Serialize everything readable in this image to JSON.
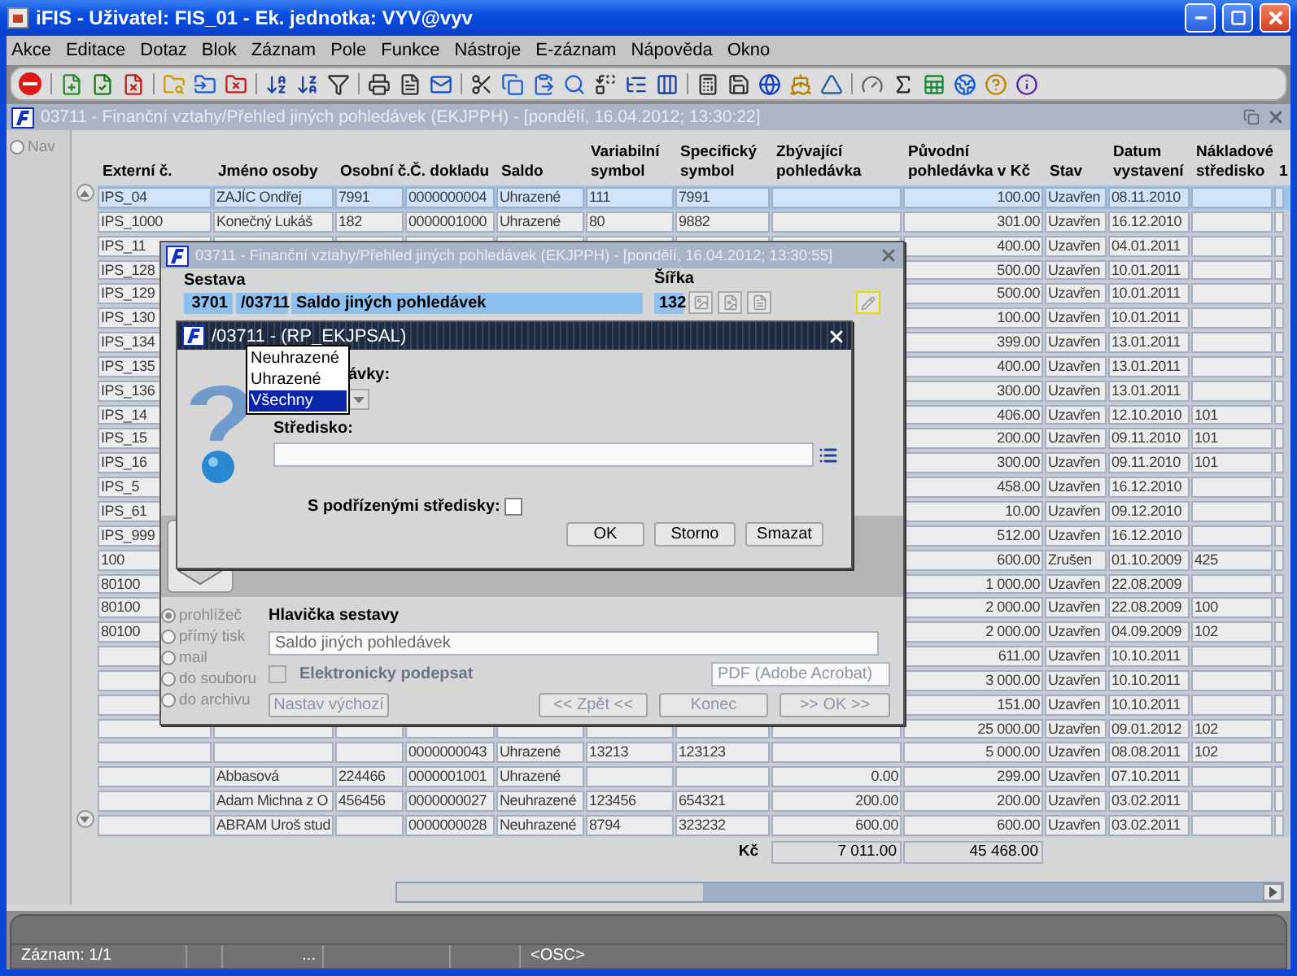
{
  "window": {
    "title": "iFIS - Uživatel: FIS_01 - Ek. jednotka: VYV@vyv"
  },
  "menu": [
    "Akce",
    "Editace",
    "Dotaz",
    "Blok",
    "Záznam",
    "Pole",
    "Funkce",
    "Nástroje",
    "E-záznam",
    "Nápověda",
    "Okno"
  ],
  "inner_window": {
    "title": "03711 - Finanční vztahy/Přehled jiných pohledávek (EKJPPH) - [pondělí, 16.04.2012; 13:30:22]"
  },
  "nav": {
    "label": "Nav"
  },
  "table": {
    "columns": [
      {
        "lines": [
          "Externí č."
        ]
      },
      {
        "lines": [
          "Jméno osoby"
        ]
      },
      {
        "lines": [
          "Osobní č."
        ]
      },
      {
        "lines": [
          "Č. dokladu"
        ]
      },
      {
        "lines": [
          "Saldo"
        ]
      },
      {
        "lines": [
          "Variabilní",
          "symbol"
        ]
      },
      {
        "lines": [
          "Specifický",
          "symbol"
        ]
      },
      {
        "lines": [
          "Zbývající",
          "pohledávka"
        ]
      },
      {
        "lines": [
          "Původní",
          "pohledávka v Kč"
        ]
      },
      {
        "lines": [
          "Stav"
        ]
      },
      {
        "lines": [
          "Datum",
          "vystavení"
        ]
      },
      {
        "lines": [
          "Nákladové",
          "středisko"
        ]
      },
      {
        "lines": [
          "1"
        ]
      }
    ],
    "rows": [
      {
        "selected": true,
        "cells": [
          "IPS_04",
          "ZAJÍC Ondřej",
          "7991",
          "0000000004",
          "Uhrazené",
          "111",
          "7991",
          null,
          "100.00",
          "Uzavřen",
          "08.11.2010",
          null,
          null
        ]
      },
      {
        "selected": false,
        "cells": [
          "IPS_1000",
          "Konečný Lukáš",
          "182",
          "0000001000",
          "Uhrazené",
          "80",
          "9882",
          null,
          "301.00",
          "Uzavřen",
          "16.12.2010",
          null,
          null
        ]
      },
      {
        "selected": false,
        "cells": [
          "IPS_11",
          null,
          null,
          null,
          null,
          null,
          null,
          null,
          "400.00",
          "Uzavřen",
          "04.01.2011",
          null,
          null
        ]
      },
      {
        "selected": false,
        "cells": [
          "IPS_128",
          null,
          null,
          null,
          null,
          null,
          null,
          null,
          "500.00",
          "Uzavřen",
          "10.01.2011",
          null,
          null
        ]
      },
      {
        "selected": false,
        "cells": [
          "IPS_129",
          null,
          null,
          null,
          null,
          null,
          null,
          null,
          "500.00",
          "Uzavřen",
          "10.01.2011",
          null,
          null
        ]
      },
      {
        "selected": false,
        "cells": [
          "IPS_130",
          null,
          null,
          null,
          null,
          null,
          null,
          null,
          "100.00",
          "Uzavřen",
          "10.01.2011",
          null,
          null
        ]
      },
      {
        "selected": false,
        "cells": [
          "IPS_134",
          null,
          null,
          null,
          null,
          null,
          null,
          null,
          "399.00",
          "Uzavřen",
          "13.01.2011",
          null,
          null
        ]
      },
      {
        "selected": false,
        "cells": [
          "IPS_135",
          null,
          null,
          null,
          null,
          null,
          null,
          null,
          "400.00",
          "Uzavřen",
          "13.01.2011",
          null,
          null
        ]
      },
      {
        "selected": false,
        "cells": [
          "IPS_136",
          null,
          null,
          null,
          null,
          null,
          null,
          null,
          "300.00",
          "Uzavřen",
          "13.01.2011",
          null,
          null
        ]
      },
      {
        "selected": false,
        "cells": [
          "IPS_14",
          null,
          null,
          null,
          null,
          null,
          null,
          null,
          "406.00",
          "Uzavřen",
          "12.10.2010",
          "101",
          null
        ]
      },
      {
        "selected": false,
        "cells": [
          "IPS_15",
          null,
          null,
          null,
          null,
          null,
          null,
          null,
          "200.00",
          "Uzavřen",
          "09.11.2010",
          "101",
          null
        ]
      },
      {
        "selected": false,
        "cells": [
          "IPS_16",
          null,
          null,
          null,
          null,
          null,
          null,
          null,
          "300.00",
          "Uzavřen",
          "09.11.2010",
          "101",
          null
        ]
      },
      {
        "selected": false,
        "cells": [
          "IPS_5",
          null,
          null,
          null,
          null,
          null,
          null,
          null,
          "458.00",
          "Uzavřen",
          "16.12.2010",
          null,
          null
        ]
      },
      {
        "selected": false,
        "cells": [
          "IPS_61",
          null,
          null,
          null,
          null,
          null,
          null,
          null,
          "10.00",
          "Uzavřen",
          "09.12.2010",
          null,
          null
        ]
      },
      {
        "selected": false,
        "cells": [
          "IPS_999",
          null,
          null,
          null,
          null,
          null,
          null,
          null,
          "512.00",
          "Uzavřen",
          "16.12.2010",
          null,
          null
        ]
      },
      {
        "selected": false,
        "cells": [
          "100",
          null,
          null,
          null,
          null,
          null,
          null,
          null,
          "600.00",
          "Zrušen",
          "01.10.2009",
          "425",
          null
        ]
      },
      {
        "selected": false,
        "cells": [
          "80100",
          null,
          null,
          null,
          null,
          null,
          null,
          null,
          "1 000.00",
          "Uzavřen",
          "22.08.2009",
          null,
          null
        ]
      },
      {
        "selected": false,
        "cells": [
          "80100",
          null,
          null,
          null,
          null,
          null,
          null,
          null,
          "2 000.00",
          "Uzavřen",
          "22.08.2009",
          "100",
          null
        ]
      },
      {
        "selected": false,
        "cells": [
          "80100",
          null,
          null,
          null,
          null,
          null,
          null,
          null,
          "2 000.00",
          "Uzavřen",
          "04.09.2009",
          "102",
          null
        ]
      },
      {
        "selected": false,
        "cells": [
          null,
          null,
          null,
          null,
          null,
          null,
          null,
          null,
          "611.00",
          "Uzavřen",
          "10.10.2011",
          null,
          null
        ]
      },
      {
        "selected": false,
        "cells": [
          null,
          null,
          null,
          null,
          null,
          null,
          null,
          null,
          "3 000.00",
          "Uzavřen",
          "10.10.2011",
          null,
          null
        ]
      },
      {
        "selected": false,
        "cells": [
          null,
          null,
          null,
          null,
          null,
          null,
          null,
          null,
          "151.00",
          "Uzavřen",
          "10.10.2011",
          null,
          null
        ]
      },
      {
        "selected": false,
        "cells": [
          null,
          null,
          null,
          null,
          null,
          null,
          null,
          null,
          "25 000.00",
          "Uzavřen",
          "09.01.2012",
          "102",
          null
        ]
      },
      {
        "selected": false,
        "cells": [
          null,
          null,
          null,
          "0000000043",
          "Uhrazené",
          "13213",
          "123123",
          null,
          "5 000.00",
          "Uzavřen",
          "08.08.2011",
          "102",
          null
        ]
      },
      {
        "selected": false,
        "cells": [
          null,
          "Abbasová",
          "224466",
          "0000001001",
          "Uhrazené",
          null,
          null,
          "0.00",
          "299.00",
          "Uzavřen",
          "07.10.2011",
          null,
          null
        ]
      },
      {
        "selected": false,
        "cells": [
          null,
          "Adam Michna z O",
          "456456",
          "0000000027",
          "Neuhrazené",
          "123456",
          "654321",
          "200.00",
          "200.00",
          "Uzavřen",
          "03.02.2011",
          null,
          null
        ]
      },
      {
        "selected": false,
        "cells": [
          null,
          "ABRAM Uroš stud",
          null,
          "0000000028",
          "Neuhrazené",
          "8794",
          "323232",
          "600.00",
          "600.00",
          "Uzavřen",
          "03.02.2011",
          null,
          null
        ]
      }
    ]
  },
  "totals": {
    "label": "Kč",
    "remaining": "7 011.00",
    "original": "45 468.00"
  },
  "report_dialog": {
    "title": "03711 - Finanční vztahy/Přehled jiných pohledávek (EKJPPH) - [pondělí, 16.04.2012; 13:30:55]",
    "report_label": "Sestava",
    "report_number": "3701",
    "report_code": "/03711",
    "report_name": "Saldo jiných pohledávek",
    "width_label": "Šířka",
    "width_value": "132",
    "outputs": [
      {
        "label": "prohlížeč",
        "selected": true
      },
      {
        "label": "přímý tisk",
        "selected": false
      },
      {
        "label": "mail",
        "selected": false
      },
      {
        "label": "do souboru",
        "selected": false
      },
      {
        "label": "do archivu",
        "selected": false
      }
    ],
    "header_label": "Hlavička sestavy",
    "header_value": "Saldo jiných pohledávek",
    "sign": {
      "label": "Elektronicky podepsat",
      "checked": false
    },
    "format": "PDF (Adobe Acrobat)",
    "buttons": [
      "Nastav výchozí",
      "<< Zpět <<",
      "Konec",
      ">> OK >>"
    ]
  },
  "param_dialog": {
    "title": "/03711 - (RP_EKJPSAL)",
    "balance_label": "ávky:",
    "dropdown_options": [
      {
        "label": "Neuhrazené",
        "selected": false
      },
      {
        "label": "Uhrazené",
        "selected": false
      },
      {
        "label": "Všechny",
        "selected": true
      }
    ],
    "center_label": "Středisko:",
    "subcenters": {
      "label": "S podřízenými středisky:",
      "checked": false
    },
    "buttons": [
      "OK",
      "Storno",
      "Smazat"
    ]
  },
  "status_bar": {
    "record": "Záznam: 1/1",
    "field_3": "...",
    "mode": "<OSC>"
  }
}
